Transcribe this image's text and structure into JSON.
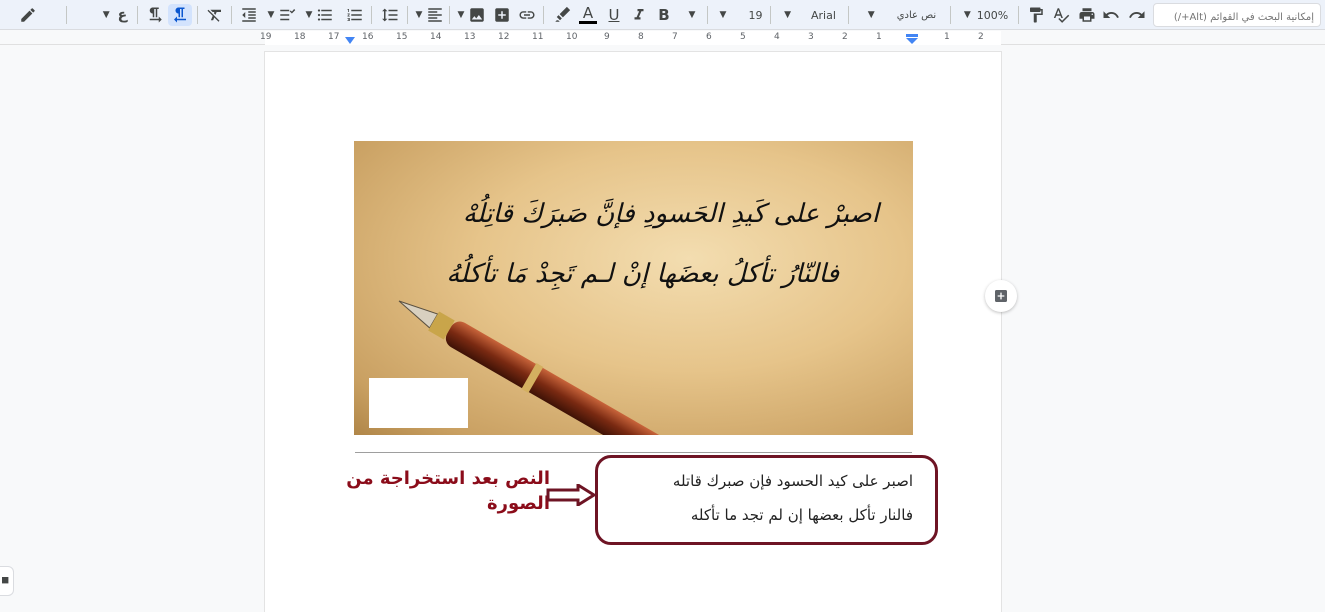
{
  "toolbar": {
    "search_placeholder": "إمكانية البحث في القوائم (Alt+/)",
    "zoom": "100%",
    "style": "نص عادي",
    "font": "Arial",
    "font_size": "19",
    "language_glyph": "ع",
    "bold": "B",
    "underline": "U",
    "text_color": "A"
  },
  "ruler": {
    "numbers": [
      "19",
      "18",
      "17",
      "16",
      "15",
      "14",
      "13",
      "12",
      "11",
      "10",
      "9",
      "8",
      "7",
      "6",
      "5",
      "4",
      "3",
      "2",
      "1",
      "1",
      "2"
    ]
  },
  "image": {
    "line1": "اصبرْ على كَيدِ الحَسودِ فإنَّ صَبرَكَ قاتِلُهْ",
    "line2": "فالنّارُ تأكلُ بعضَها إنْ لـم تَجِدْ مَا تأكلُهُ"
  },
  "caption": {
    "text": "النص بعد استخراجة من الصورة"
  },
  "textbox": {
    "line1": "اصبر على كيد الحسود فإن صبرك قاتله",
    "line2": "فالنار تأكل بعضها إن لم تجد ما تأكله"
  },
  "colors": {
    "caption": "#8b0c1a",
    "textbox_border": "#6e1424",
    "toolbar_bg": "#edf2fa",
    "active_button_bg": "#d3e3fd"
  }
}
